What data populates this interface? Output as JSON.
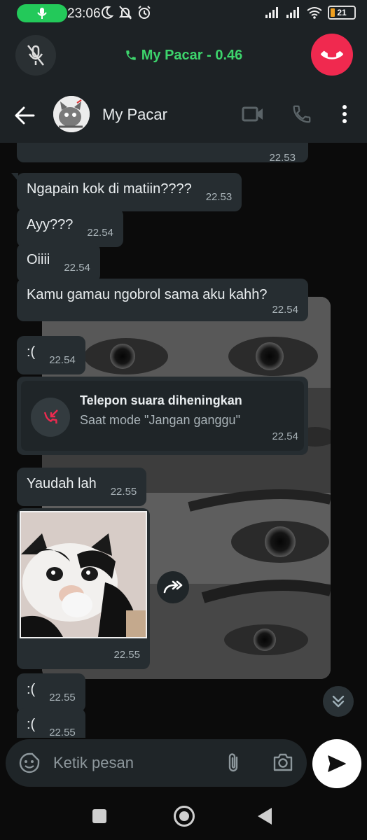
{
  "status_bar": {
    "time": "23:06",
    "battery": "21"
  },
  "call": {
    "title": "My Pacar - 0.46",
    "accent": "#3dd46c",
    "end_color": "#f0294f"
  },
  "header": {
    "contact_name": "My Pacar"
  },
  "messages": [
    {
      "text": "",
      "time": "22.53"
    },
    {
      "text": "Ngapain kok di matiin????",
      "time": "22.53"
    },
    {
      "text": "Ayy???",
      "time": "22.54"
    },
    {
      "text": "Oiiii",
      "time": "22.54"
    },
    {
      "text": "Kamu gamau ngobrol sama aku kahh?",
      "time": "22.54"
    },
    {
      "text": ":(",
      "time": "22.54"
    },
    {
      "text": "Yaudah lah",
      "time": "22.55"
    },
    {
      "text": ":(",
      "time": "22.55"
    },
    {
      "text": ":(",
      "time": "22.55"
    }
  ],
  "call_card": {
    "title": "Telepon suara diheningkan",
    "subtitle": "Saat mode \"Jangan ganggu\"",
    "time": "22.54"
  },
  "image_message": {
    "time": "22.55"
  },
  "composer": {
    "placeholder": "Ketik pesan"
  },
  "icons": [
    "mic-icon",
    "moon-icon",
    "bell-off-icon",
    "alarm-icon",
    "signal-icon",
    "wifi-icon",
    "battery-icon",
    "mic-off-icon",
    "phone-icon",
    "end-call-icon",
    "back-arrow-icon",
    "video-icon",
    "more-vert-icon",
    "missed-call-icon",
    "forward-icon",
    "chevron-double-down-icon",
    "sticker-icon",
    "attach-icon",
    "camera-icon",
    "send-icon"
  ]
}
